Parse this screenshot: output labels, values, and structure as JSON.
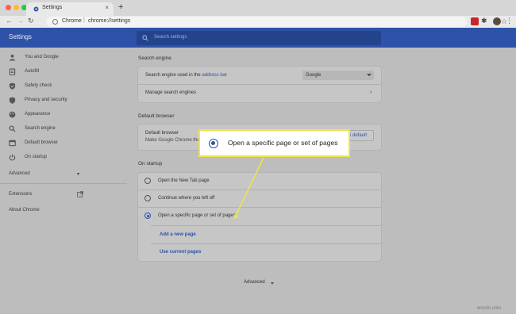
{
  "browser": {
    "tab_title": "Settings",
    "tab_close": "×",
    "new_tab": "+",
    "url_site": "Chrome",
    "url_separator": "|",
    "url_path": "chrome://settings"
  },
  "header": {
    "title": "Settings",
    "search_placeholder": "Search settings"
  },
  "sidebar": {
    "items": [
      {
        "label": "You and Google",
        "icon": "person-icon"
      },
      {
        "label": "Autofill",
        "icon": "clipboard-icon"
      },
      {
        "label": "Safety check",
        "icon": "shield-check-icon"
      },
      {
        "label": "Privacy and security",
        "icon": "shield-icon"
      },
      {
        "label": "Appearance",
        "icon": "palette-icon"
      },
      {
        "label": "Search engine",
        "icon": "search-icon"
      },
      {
        "label": "Default browser",
        "icon": "browser-icon"
      },
      {
        "label": "On startup",
        "icon": "power-icon"
      }
    ],
    "advanced": "Advanced",
    "extensions": "Extensions",
    "about": "About Chrome"
  },
  "search_engine": {
    "section_title": "Search engine",
    "used_in_label": "Search engine used in the",
    "used_in_link": "address bar",
    "selected_engine": "Google",
    "manage_label": "Manage search engines"
  },
  "default_browser": {
    "section_title": "Default browser",
    "row_title": "Default browser",
    "row_subtitle": "Make Google Chrome the d",
    "make_default_button": "se default"
  },
  "on_startup": {
    "section_title": "On startup",
    "options": [
      {
        "label": "Open the New Tab page",
        "checked": false
      },
      {
        "label": "Continue where you left off",
        "checked": false
      },
      {
        "label": "Open a specific page or set of pages",
        "checked": true
      }
    ],
    "add_page_link": "Add a new page",
    "use_current_link": "Use current pages"
  },
  "advanced_footer": "Advanced",
  "callout": {
    "text": "Open a specific page or set of pages",
    "highlight_color": "#f0e54a"
  },
  "watermark": "wsxdn.com",
  "colors": {
    "brand_blue": "#2d52a8",
    "overlay_gray": "#bdbdbd"
  }
}
